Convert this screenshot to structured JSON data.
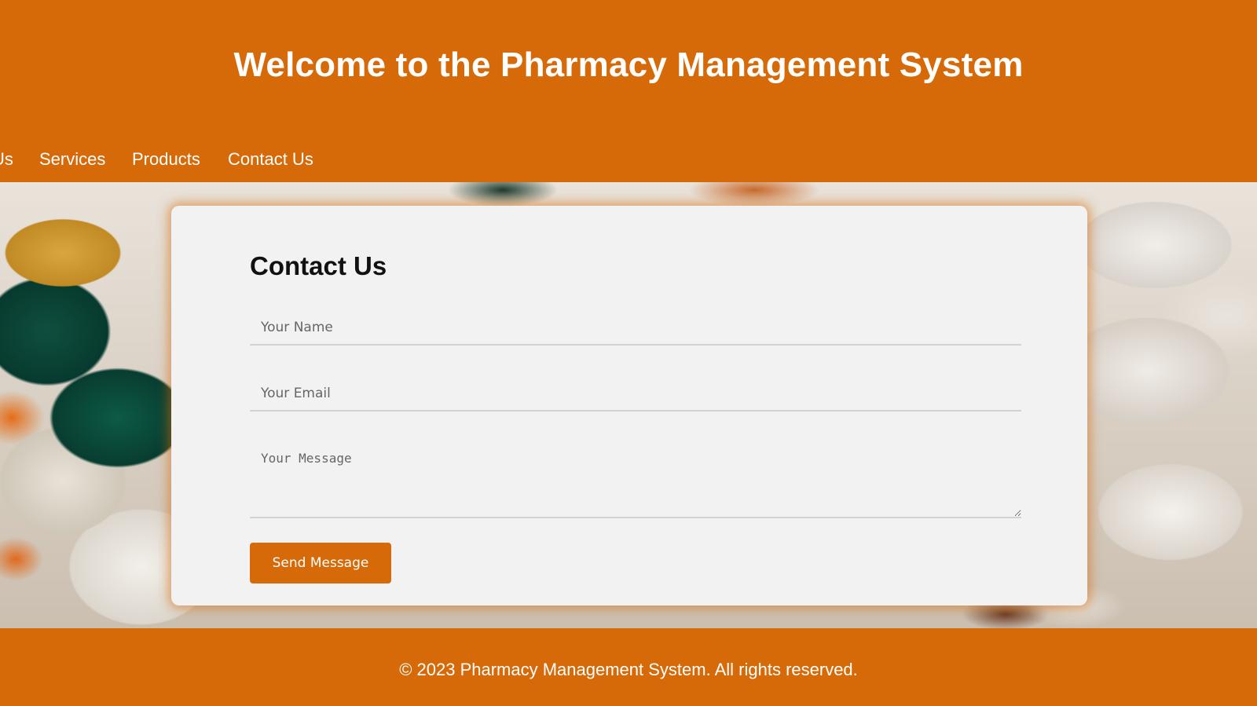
{
  "header": {
    "title": "Welcome to the Pharmacy Management System"
  },
  "nav": {
    "items": [
      {
        "label": "Us"
      },
      {
        "label": "Services"
      },
      {
        "label": "Products"
      },
      {
        "label": "Contact Us"
      }
    ]
  },
  "contact": {
    "heading": "Contact Us",
    "name_placeholder": "Your Name",
    "email_placeholder": "Your Email",
    "message_placeholder": "Your Message",
    "submit_label": "Send Message"
  },
  "footer": {
    "text": "© 2023 Pharmacy Management System. All rights reserved."
  },
  "colors": {
    "brand": "#d66a09",
    "card_background": "#f2f2f2"
  }
}
